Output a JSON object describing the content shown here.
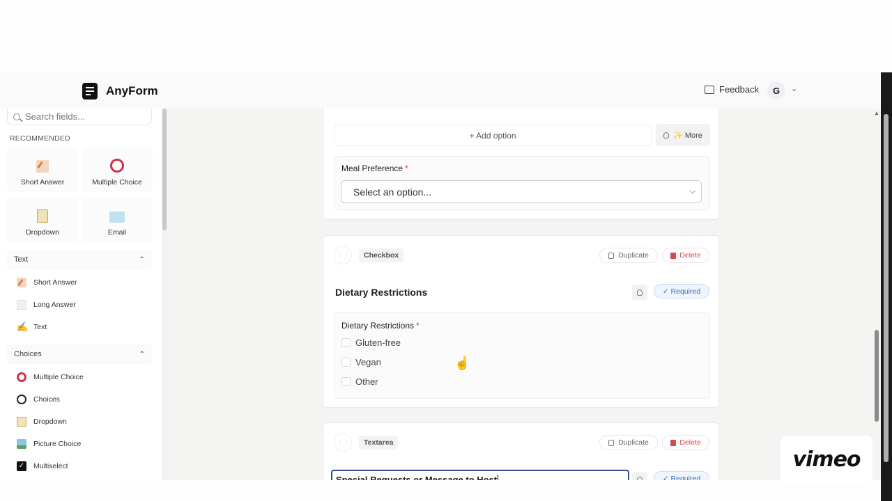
{
  "app": {
    "name": "AnyForm"
  },
  "header": {
    "feedback_label": "Feedback",
    "avatar_initial": "G"
  },
  "sidebar": {
    "search_placeholder": "Search fields...",
    "recommended_label": "RECOMMENDED",
    "recommended": [
      {
        "label": "Short Answer",
        "icon": "pencil-icon"
      },
      {
        "label": "Multiple Choice",
        "icon": "ring-icon"
      },
      {
        "label": "Dropdown",
        "icon": "clipboard-icon"
      },
      {
        "label": "Email",
        "icon": "mail-icon"
      }
    ],
    "sections": [
      {
        "title": "Text",
        "items": [
          {
            "label": "Short Answer",
            "icon": "pencil-icon"
          },
          {
            "label": "Long Answer",
            "icon": "document-icon"
          },
          {
            "label": "Text",
            "icon": "hand-icon"
          }
        ]
      },
      {
        "title": "Choices",
        "items": [
          {
            "label": "Multiple Choice",
            "icon": "ring-icon"
          },
          {
            "label": "Choices",
            "icon": "circle-icon"
          },
          {
            "label": "Dropdown",
            "icon": "clipboard-icon"
          },
          {
            "label": "Picture Choice",
            "icon": "picture-icon"
          },
          {
            "label": "Multiselect",
            "icon": "checkbox-icon"
          }
        ]
      }
    ]
  },
  "cards": {
    "options_card": {
      "add_option_label": "+ Add option",
      "more_label": "✨ More",
      "preview_label": "Meal Preference",
      "required_mark": "*",
      "select_placeholder": "Select an option..."
    },
    "checkbox_card": {
      "type_label": "Checkbox",
      "duplicate_label": "Duplicate",
      "delete_label": "Delete",
      "question_title": "Dietary Restrictions",
      "required_label": "✓ Required",
      "preview_label": "Dietary Restrictions",
      "required_mark": "*",
      "options": [
        "Gluten-free",
        "Vegan",
        "Other"
      ]
    },
    "textarea_card": {
      "type_label": "Textarea",
      "duplicate_label": "Duplicate",
      "delete_label": "Delete",
      "title_input_value": "Special Requests or Message to Host",
      "required_label": "✓ Required"
    }
  },
  "watermark": {
    "text": "vimeo"
  }
}
